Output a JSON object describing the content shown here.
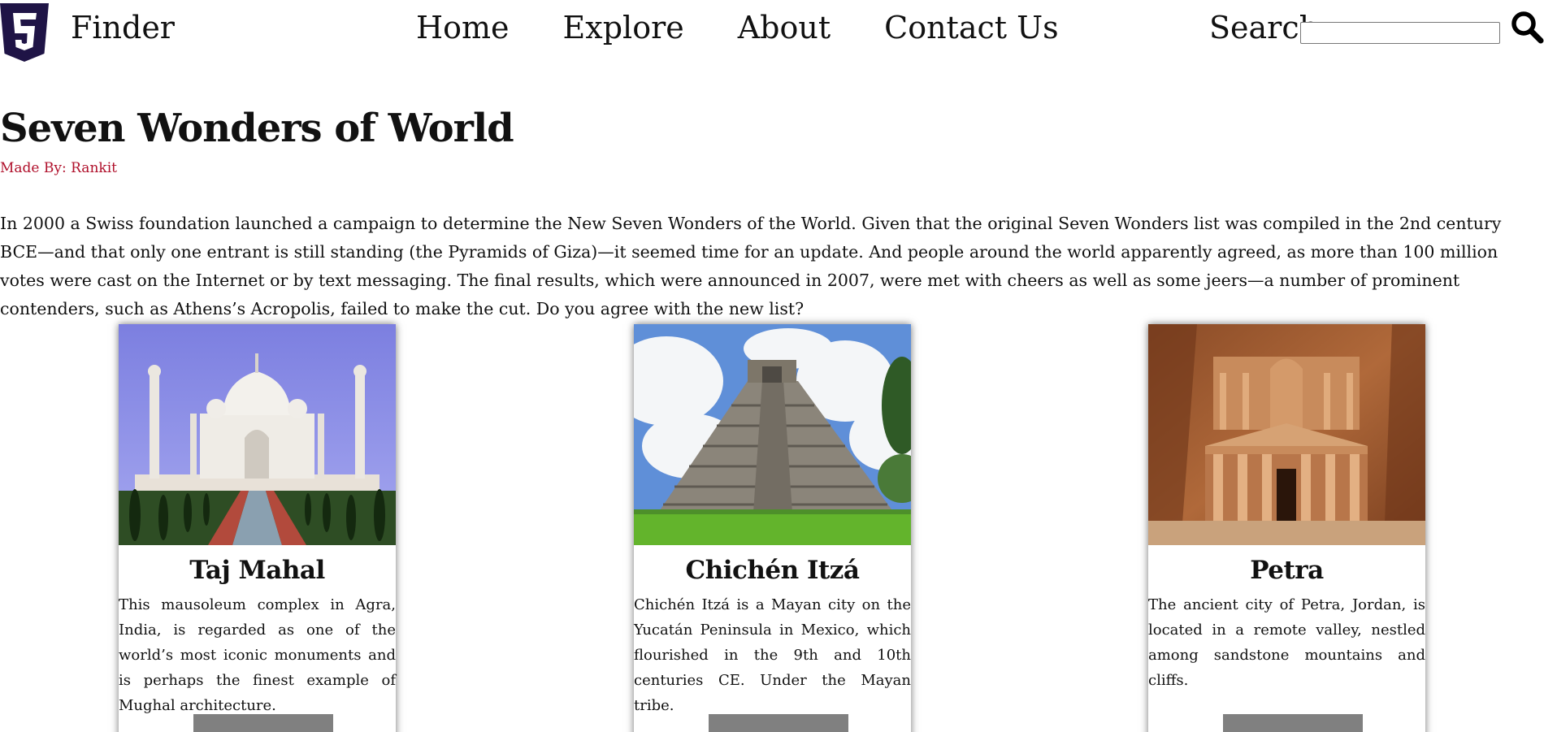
{
  "nav": {
    "brand": "Finder",
    "links": [
      "Home",
      "Explore",
      "About",
      "Contact Us"
    ],
    "search_label": "Search",
    "search_value": "",
    "logo_icon": "html5-logo-icon",
    "search_icon": "magnifier-icon"
  },
  "page": {
    "title": "Seven Wonders of World",
    "byline": "Made By: Rankit",
    "intro": "In 2000 a Swiss foundation launched a campaign to determine the New Seven Wonders of the World. Given that the original Seven Wonders list was compiled in the 2nd century BCE—and that only one entrant is still standing (the Pyramids of Giza)—it seemed time for an update. And people around the world apparently agreed, as more than 100 million votes were cast on the Internet or by text messaging. The final results, which were announced in 2007, were met with cheers as well as some jeers—a number of prominent contenders, such as Athens’s Acropolis, failed to make the cut. Do you agree with the new list?"
  },
  "cards": [
    {
      "title": "Taj Mahal",
      "text": "This mausoleum complex in Agra, India, is regarded as one of the world’s most iconic monuments and is perhaps the finest example of Mughal architecture.",
      "button_label": ""
    },
    {
      "title": "Chichén Itzá",
      "text": "Chichén Itzá is a Mayan city on the Yucatán Peninsula in Mexico, which flourished in the 9th and 10th centuries CE. Under the Mayan tribe.",
      "button_label": ""
    },
    {
      "title": "Petra",
      "text": "The ancient city of Petra, Jordan, is located in a remote valley, nestled among sandstone mountains and cliffs.",
      "button_label": ""
    }
  ],
  "colors": {
    "logo": "#1f1446",
    "byline": "#b0102b",
    "button": "#808080"
  }
}
